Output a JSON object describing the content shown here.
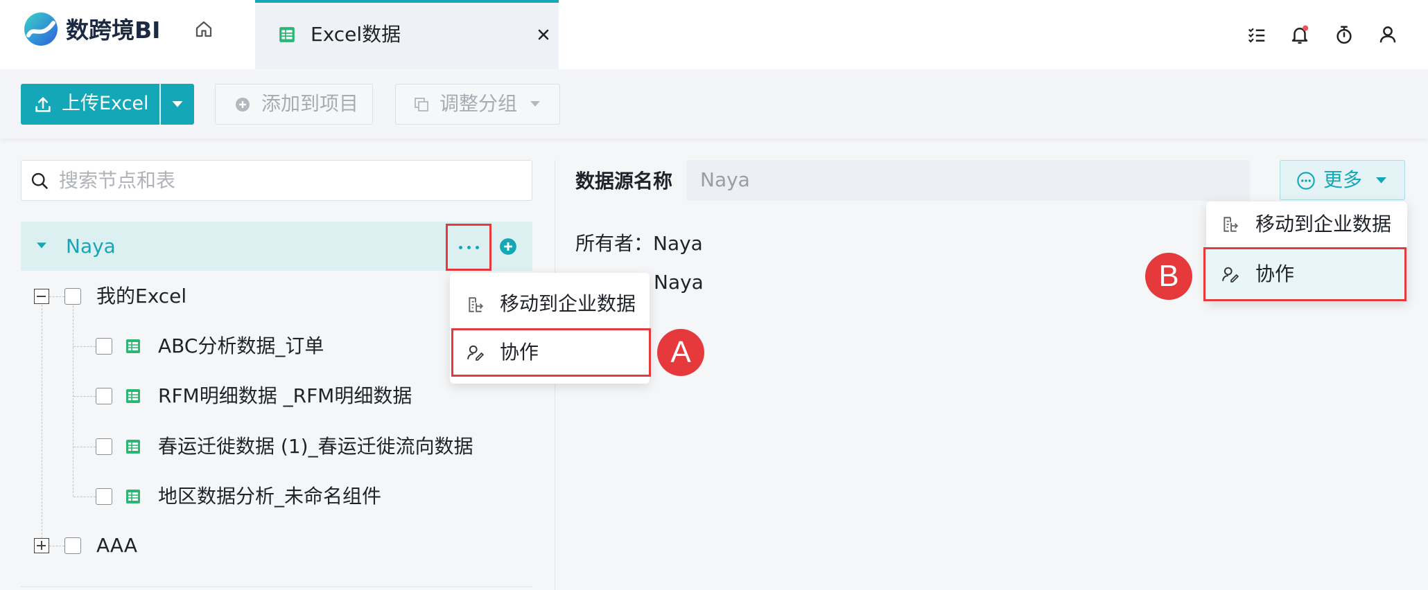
{
  "colors": {
    "accent": "#13a7b7",
    "accent_text": "#1aa3b4",
    "annotation_red": "#e5393c",
    "excel_green": "#2bb673",
    "row_highlight": "#dcf0f2"
  },
  "app": {
    "logo_text": "数跨境BI"
  },
  "header": {
    "home_icon": "home-icon",
    "icons": [
      "checklist-icon",
      "bell-icon",
      "stopwatch-icon",
      "user-icon"
    ]
  },
  "tabs": [
    {
      "label": "Excel数据",
      "icon": "excel-icon",
      "active": true
    }
  ],
  "toolbar": {
    "upload_label": "上传Excel",
    "add_to_project_label": "添加到项目",
    "adjust_group_label": "调整分组"
  },
  "search": {
    "placeholder": "搜索节点和表"
  },
  "tree": {
    "root": {
      "label": "Naya",
      "expanded": true
    },
    "folders": [
      {
        "label": "我的Excel",
        "expanded": true,
        "children": [
          {
            "label": "ABC分析数据_订单"
          },
          {
            "label": "RFM明细数据 _RFM明细数据"
          },
          {
            "label": "春运迁徙数据 (1)_春运迁徙流向数据"
          },
          {
            "label": "地区数据分析_未命名组件"
          }
        ]
      },
      {
        "label": "AAA",
        "expanded": false
      }
    ]
  },
  "tree_menu": {
    "items": [
      {
        "label": "移动到企业数据",
        "icon": "move-to-enterprise-icon"
      },
      {
        "label": "协作",
        "icon": "collaborate-icon"
      }
    ]
  },
  "detail": {
    "name_label": "数据源名称",
    "name_value": "Naya",
    "owner_label": "所有者：",
    "owner_value": "Naya",
    "second_value": "Naya"
  },
  "more_button": {
    "label": "更多"
  },
  "more_menu": {
    "items": [
      {
        "label": "移动到企业数据",
        "icon": "move-to-enterprise-icon"
      },
      {
        "label": "协作",
        "icon": "collaborate-icon"
      }
    ]
  },
  "annotations": {
    "a": "A",
    "b": "B"
  }
}
